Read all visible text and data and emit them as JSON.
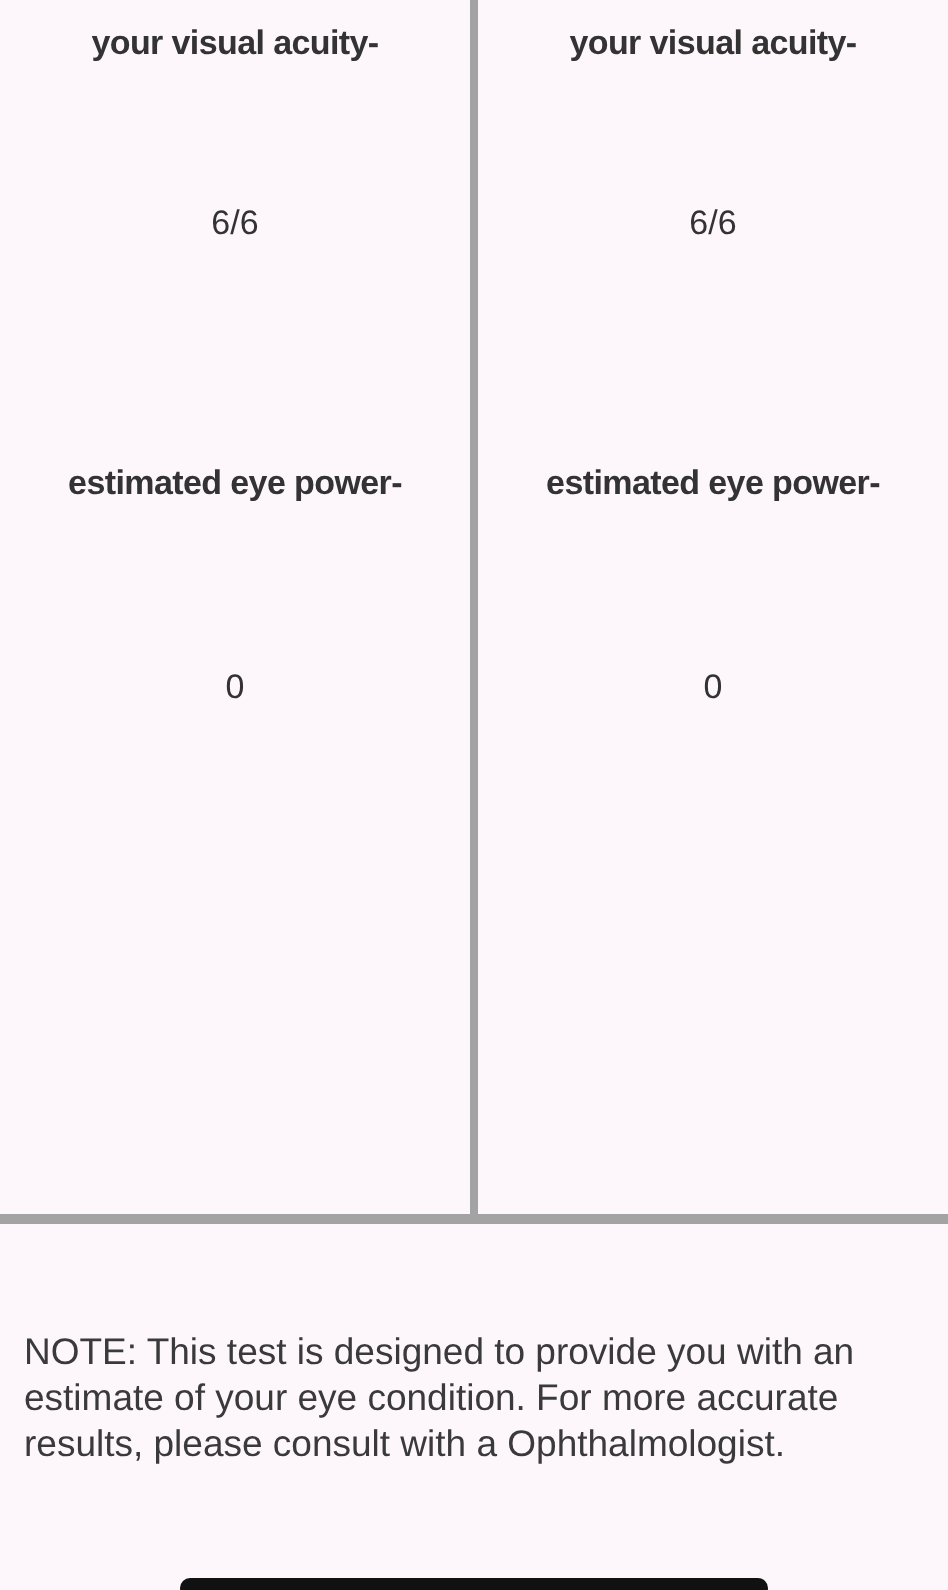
{
  "eyes": [
    {
      "acuity_label": "your visual acuity-",
      "acuity": "6/6",
      "power_label": "estimated eye power-",
      "power": "0"
    },
    {
      "acuity_label": "your visual acuity-",
      "acuity": "6/6",
      "power_label": "estimated eye power-",
      "power": "0"
    }
  ],
  "note": "NOTE: This test is designed to provide you with an estimate of your eye condition. For more accurate results, please consult with a Ophthalmologist."
}
